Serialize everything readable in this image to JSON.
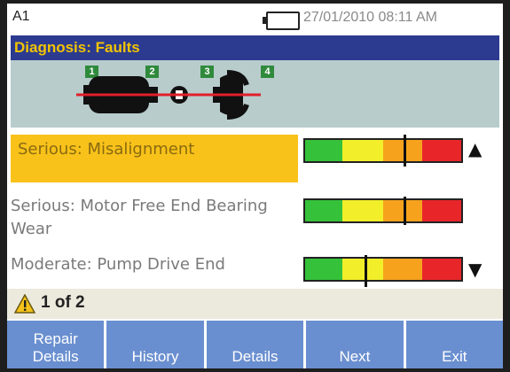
{
  "status_bar": {
    "location": "A1",
    "datetime": "27/01/2010 08:11 AM",
    "battery_icon": "battery-icon"
  },
  "title": "Diagnosis: Faults",
  "diagram": {
    "badges": [
      "1",
      "2",
      "3",
      "4"
    ],
    "icons": [
      "motor-icon",
      "coupling-icon",
      "pump-icon"
    ]
  },
  "faults": [
    {
      "label": "Serious:  Misalignment",
      "selected": true,
      "severity_fraction": 0.63
    },
    {
      "label": "Serious: Motor Free End Bearing Wear",
      "selected": false,
      "severity_fraction": 0.63
    },
    {
      "label": "Moderate: Pump Drive End",
      "selected": false,
      "severity_fraction": 0.38
    }
  ],
  "severity_colors": [
    "#35c13a",
    "#f2ee2a",
    "#f6a21d",
    "#e8262a"
  ],
  "scroll": {
    "up_icon": "triangle-up-icon",
    "down_icon": "triangle-down-icon"
  },
  "footer": {
    "warning_icon": "warning-icon",
    "count_text": "1 of 2"
  },
  "softkeys": [
    {
      "label": "Repair Details"
    },
    {
      "label": "History"
    },
    {
      "label": "Details"
    },
    {
      "label": "Next"
    },
    {
      "label": "Exit"
    }
  ]
}
